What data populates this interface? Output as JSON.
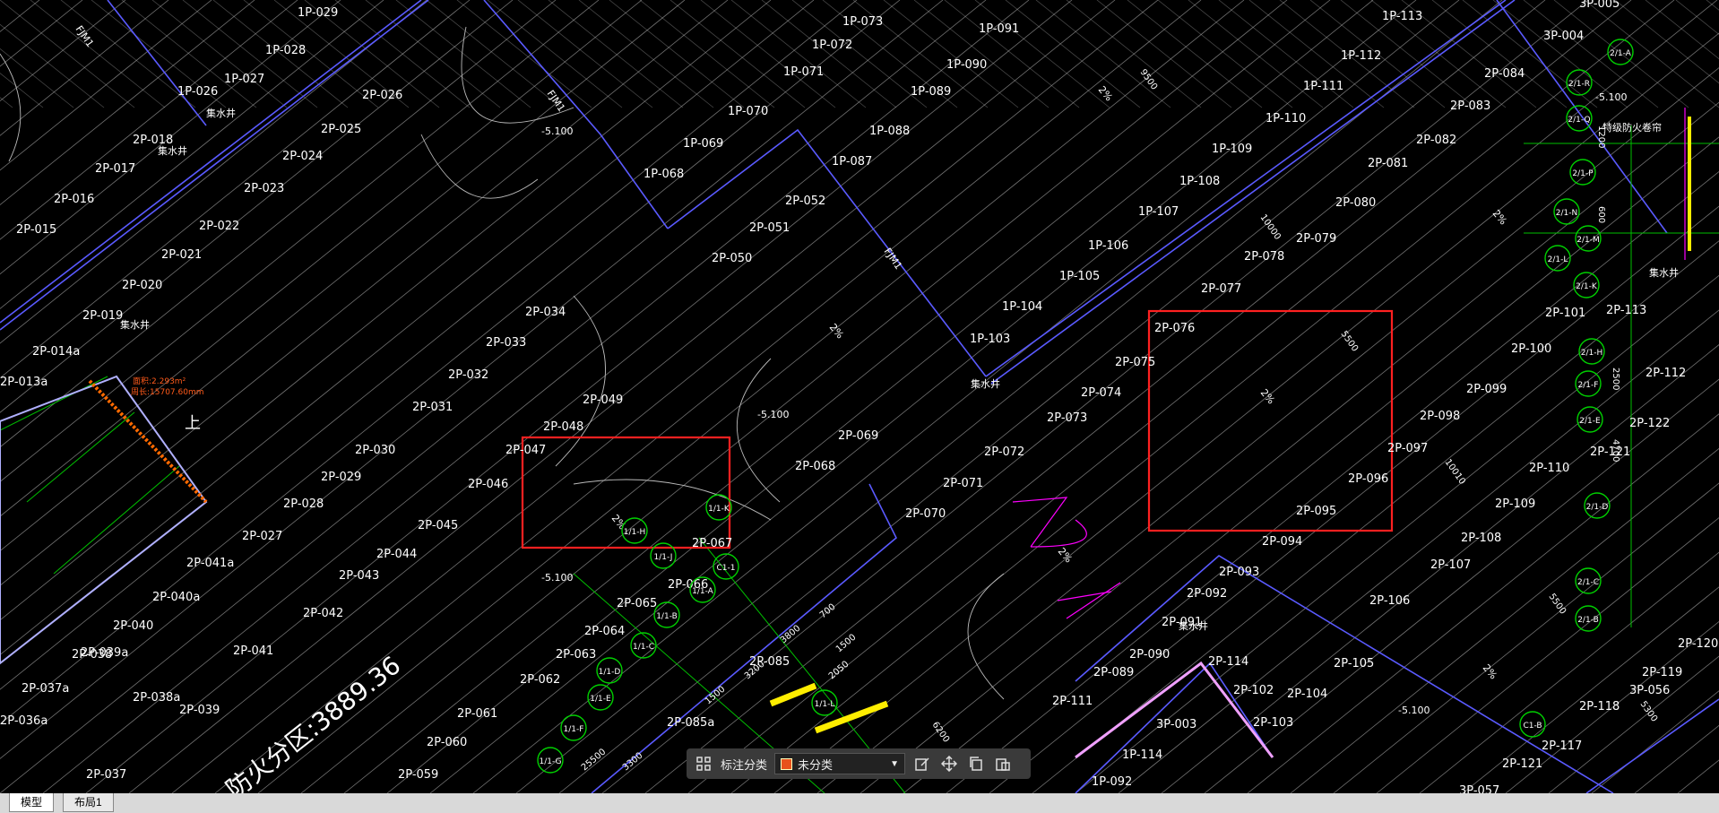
{
  "cad": {
    "spaces": [
      "1P-029",
      "1P-028",
      "1P-027",
      "1P-026",
      "2P-026",
      "2P-025",
      "2P-024",
      "2P-023",
      "2P-022",
      "2P-021",
      "2P-020",
      "2P-019",
      "2P-018",
      "2P-017",
      "2P-016",
      "2P-015",
      "2P-014a",
      "2P-013a",
      "1P-073",
      "1P-072",
      "1P-071",
      "1P-070",
      "1P-069",
      "1P-068",
      "1P-091",
      "1P-090",
      "1P-089",
      "1P-088",
      "1P-087",
      "2P-052",
      "2P-051",
      "2P-050",
      "2P-034",
      "2P-033",
      "2P-032",
      "2P-031",
      "2P-030",
      "2P-029",
      "2P-028",
      "2P-027",
      "2P-049",
      "2P-048",
      "2P-047",
      "2P-046",
      "2P-045",
      "2P-044",
      "2P-043",
      "2P-042",
      "2P-041",
      "2P-041a",
      "2P-040a",
      "2P-040",
      "2P-039a",
      "2P-039",
      "2P-038a",
      "2P-038",
      "2P-037a",
      "2P-037",
      "2P-036a",
      "1P-113",
      "1P-112",
      "1P-111",
      "1P-110",
      "1P-109",
      "1P-108",
      "1P-107",
      "1P-106",
      "1P-105",
      "1P-104",
      "1P-103",
      "2P-084",
      "2P-083",
      "2P-082",
      "2P-081",
      "2P-080",
      "2P-079",
      "2P-078",
      "2P-077",
      "2P-076",
      "2P-075",
      "2P-074",
      "2P-073",
      "2P-072",
      "2P-071",
      "2P-070",
      "2P-069",
      "2P-068",
      "2P-067",
      "2P-066",
      "2P-065",
      "2P-064",
      "2P-063",
      "2P-062",
      "2P-061",
      "2P-060",
      "2P-059",
      "2P-085",
      "2P-085a",
      "2P-101",
      "2P-100",
      "2P-099",
      "2P-098",
      "2P-097",
      "2P-096",
      "2P-095",
      "2P-094",
      "2P-093",
      "2P-092",
      "2P-091",
      "2P-090",
      "2P-089",
      "2P-111",
      "2P-110",
      "2P-109",
      "2P-108",
      "2P-107",
      "2P-106",
      "2P-105",
      "2P-104",
      "2P-103",
      "2P-102",
      "2P-114",
      "2P-113",
      "2P-112",
      "2P-122",
      "2P-121",
      "2P-120",
      "2P-119",
      "2P-118",
      "2P-117",
      "2P-121",
      "3P-057",
      "3P-056",
      "3P-005",
      "3P-004",
      "3P-003",
      "1P-114",
      "1P-092"
    ],
    "level_tags": [
      "-5.100",
      "-5.100",
      "-5.100",
      "-5.100",
      "-5.100"
    ],
    "slope_tags": [
      "2%",
      "2%",
      "2%",
      "2%",
      "2%",
      "2%",
      "2%",
      "2%"
    ],
    "dim_values": [
      "9500",
      "10000",
      "5500",
      "10010",
      "5500",
      "5300",
      "3800",
      "1500",
      "2050",
      "3200",
      "1500",
      "6200",
      "700",
      "25500",
      "3300",
      "1200",
      "600",
      "4700",
      "2500"
    ],
    "axis_bubbles": [
      "2/1-R",
      "2/1-Q",
      "2/1-P",
      "2/1-N",
      "2/1-M",
      "2/1-L",
      "2/1-K",
      "2/1-H",
      "2/1-F",
      "2/1-E",
      "2/1-D",
      "2/1-C",
      "2/1-B",
      "2/1-A",
      "C1-B",
      "C1-1",
      "1/1-A",
      "1/1-B",
      "1/1-C",
      "1/1-D",
      "1/1-E",
      "1/1-F",
      "1/1-G",
      "1/1-H",
      "1/1-J",
      "1/1-K",
      "1/1-L"
    ],
    "sump_label": "集水井",
    "fire_door_label": "FJM1",
    "firezone_label": "防火分区:3889.36",
    "firewall_label": "特级防火卷帘",
    "area_annot_1": "面积:2.293m²",
    "area_annot_2": "周长:15707.60mm",
    "up_label": "上"
  },
  "toolbar": {
    "category_label": "标注分类",
    "category_value": "未分类",
    "swatch_color": "#e8521c"
  },
  "tabs": {
    "model": "模型",
    "layout1": "布局1"
  },
  "colors": {
    "background": "#000000",
    "lines": "#ffffff",
    "wall": "#4040ff",
    "highlight": "#ff2020",
    "green": "#00c000"
  }
}
